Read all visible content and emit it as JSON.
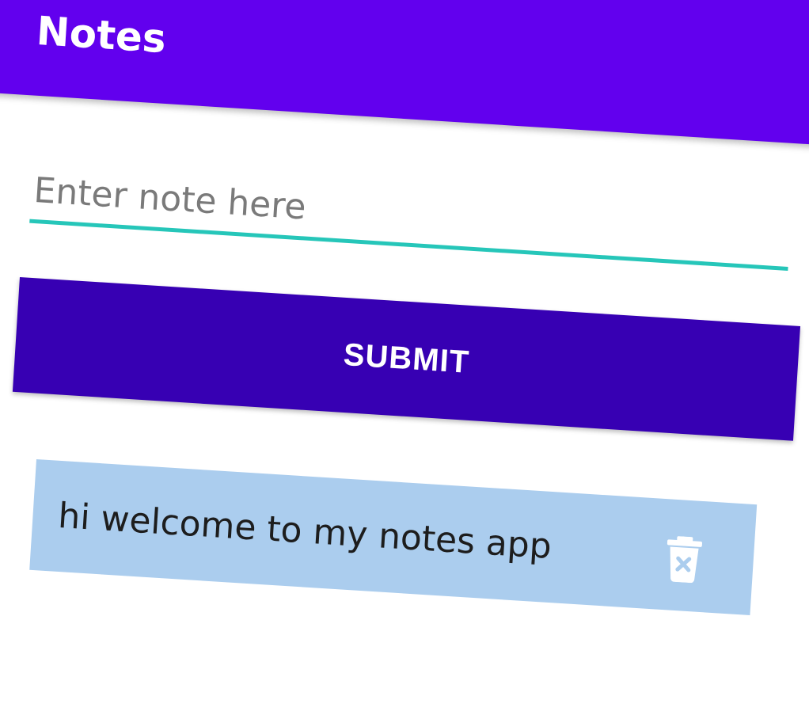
{
  "app_bar": {
    "title": "Notes"
  },
  "note_form": {
    "input_placeholder": "Enter note here",
    "input_value": "",
    "submit_label": "SUBMIT"
  },
  "notes": [
    {
      "text": "hi welcome to my notes app",
      "delete_icon": "delete-trash-icon"
    }
  ],
  "colors": {
    "app_bar": "#6200ee",
    "status_bar": "#3700b3",
    "accent": "#26c6b9",
    "button": "#3700b3",
    "note_card": "#abcdee",
    "delete_icon": "#ffffff"
  }
}
